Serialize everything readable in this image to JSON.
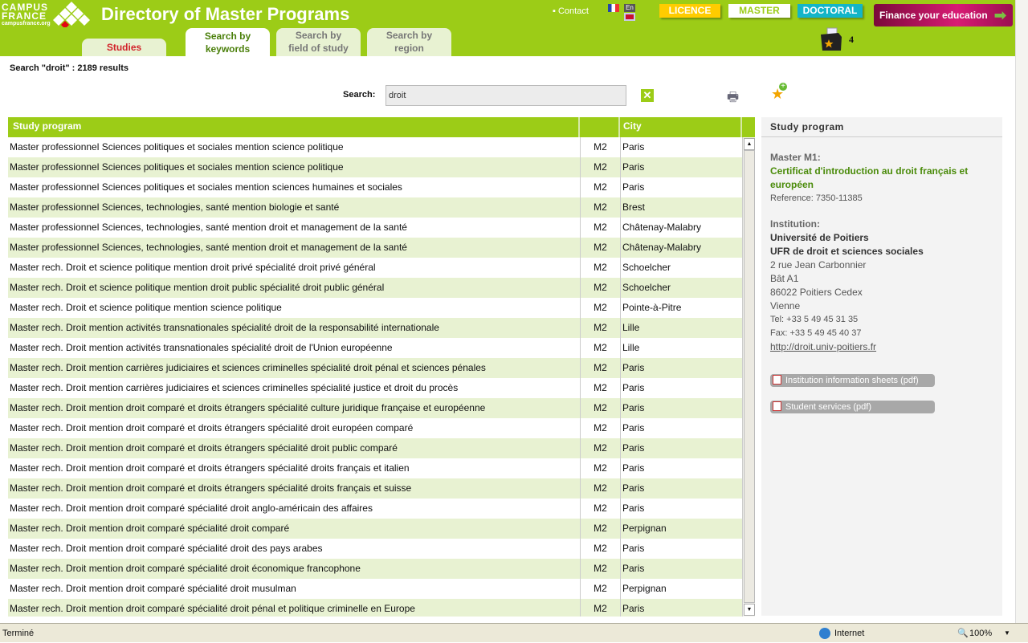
{
  "header": {
    "logo_line1": "CAMPUS",
    "logo_line2": "FRANCE",
    "logo_url": "campusfrance.org",
    "title": "Directory of Master Programs",
    "contact": "Contact",
    "lang_en": "En",
    "levels": [
      {
        "label": "LICENCE",
        "color": "#ffcc00"
      },
      {
        "label": "MASTER",
        "color": "#ffffff"
      },
      {
        "label": "DOCTORAL",
        "color": "#13b5c8"
      }
    ],
    "finance": "Finance your education",
    "cart_count": "4"
  },
  "tabs": [
    {
      "label": "Studies"
    },
    {
      "label": "Search by keywords"
    },
    {
      "label": "Search by field of study"
    },
    {
      "label": "Search by region"
    }
  ],
  "results_text": "Search \"droit\" : 2189 results",
  "search": {
    "label": "Search:",
    "value": "droit"
  },
  "table": {
    "headers": [
      "Study program",
      "",
      "City"
    ],
    "rows": [
      [
        "Master professionnel Sciences politiques et sociales mention science politique",
        "M2",
        "Paris"
      ],
      [
        "Master professionnel Sciences politiques et sociales mention science politique",
        "M2",
        "Paris"
      ],
      [
        "Master professionnel Sciences politiques et sociales mention sciences humaines et sociales",
        "M2",
        "Paris"
      ],
      [
        "Master professionnel Sciences, technologies, santé mention biologie et santé",
        "M2",
        "Brest"
      ],
      [
        "Master professionnel Sciences, technologies, santé mention droit et management de la santé",
        "M2",
        "Châtenay-Malabry"
      ],
      [
        "Master professionnel Sciences, technologies, santé mention droit et management de la santé",
        "M2",
        "Châtenay-Malabry"
      ],
      [
        "Master rech. Droit et science politique mention droit privé spécialité droit privé général",
        "M2",
        "Schoelcher"
      ],
      [
        "Master rech. Droit et science politique mention droit public spécialité droit public général",
        "M2",
        "Schoelcher"
      ],
      [
        "Master rech. Droit et science politique mention science politique",
        "M2",
        "Pointe-à-Pitre"
      ],
      [
        "Master rech. Droit mention activités transnationales spécialité droit de la responsabilité internationale",
        "M2",
        "Lille"
      ],
      [
        "Master rech. Droit mention activités transnationales spécialité droit de l'Union européenne",
        "M2",
        "Lille"
      ],
      [
        "Master rech. Droit mention carrières judiciaires et sciences criminelles spécialité droit pénal et sciences pénales",
        "M2",
        "Paris"
      ],
      [
        "Master rech. Droit mention carrières judiciaires et sciences criminelles spécialité justice et droit du procès",
        "M2",
        "Paris"
      ],
      [
        "Master rech. Droit mention droit comparé et droits étrangers spécialité culture juridique française et européenne",
        "M2",
        "Paris"
      ],
      [
        "Master rech. Droit mention droit comparé et droits étrangers spécialité droit européen comparé",
        "M2",
        "Paris"
      ],
      [
        "Master rech. Droit mention droit comparé et droits étrangers spécialité droit public comparé",
        "M2",
        "Paris"
      ],
      [
        "Master rech. Droit mention droit comparé et droits étrangers spécialité droits français et italien",
        "M2",
        "Paris"
      ],
      [
        "Master rech. Droit mention droit comparé et droits étrangers spécialité droits français et suisse",
        "M2",
        "Paris"
      ],
      [
        "Master rech. Droit mention droit comparé spécialité droit anglo-américain des affaires",
        "M2",
        "Paris"
      ],
      [
        "Master rech. Droit mention droit comparé spécialité droit comparé",
        "M2",
        "Perpignan"
      ],
      [
        "Master rech. Droit mention droit comparé spécialité droit des pays arabes",
        "M2",
        "Paris"
      ],
      [
        "Master rech. Droit mention droit comparé spécialité droit économique francophone",
        "M2",
        "Paris"
      ],
      [
        "Master rech. Droit mention droit comparé spécialité droit musulman",
        "M2",
        "Perpignan"
      ],
      [
        "Master rech. Droit mention droit comparé spécialité droit pénal et politique criminelle en Europe",
        "M2",
        "Paris"
      ]
    ]
  },
  "panel": {
    "title": "Study program",
    "level": "Master M1:",
    "program": "Certificat d'introduction au droit français et européen",
    "reference": "Reference: 7350-11385",
    "inst_label": "Institution:",
    "inst_name": "Université de Poitiers",
    "inst_unit": "UFR de droit et sciences sociales",
    "addr1": "2 rue Jean Carbonnier",
    "addr2": "Bât A1",
    "addr3": "86022 Poitiers Cedex",
    "addr4": "Vienne",
    "tel": "Tel: +33 5 49 45 31 35",
    "fax": "Fax: +33 5 49 45 40 37",
    "url": "http://droit.univ-poitiers.fr",
    "pdf1": "Institution information sheets (pdf)",
    "pdf2": "Student services (pdf)"
  },
  "status": {
    "text": "Terminé",
    "zone": "Internet",
    "zoom": "100%"
  }
}
